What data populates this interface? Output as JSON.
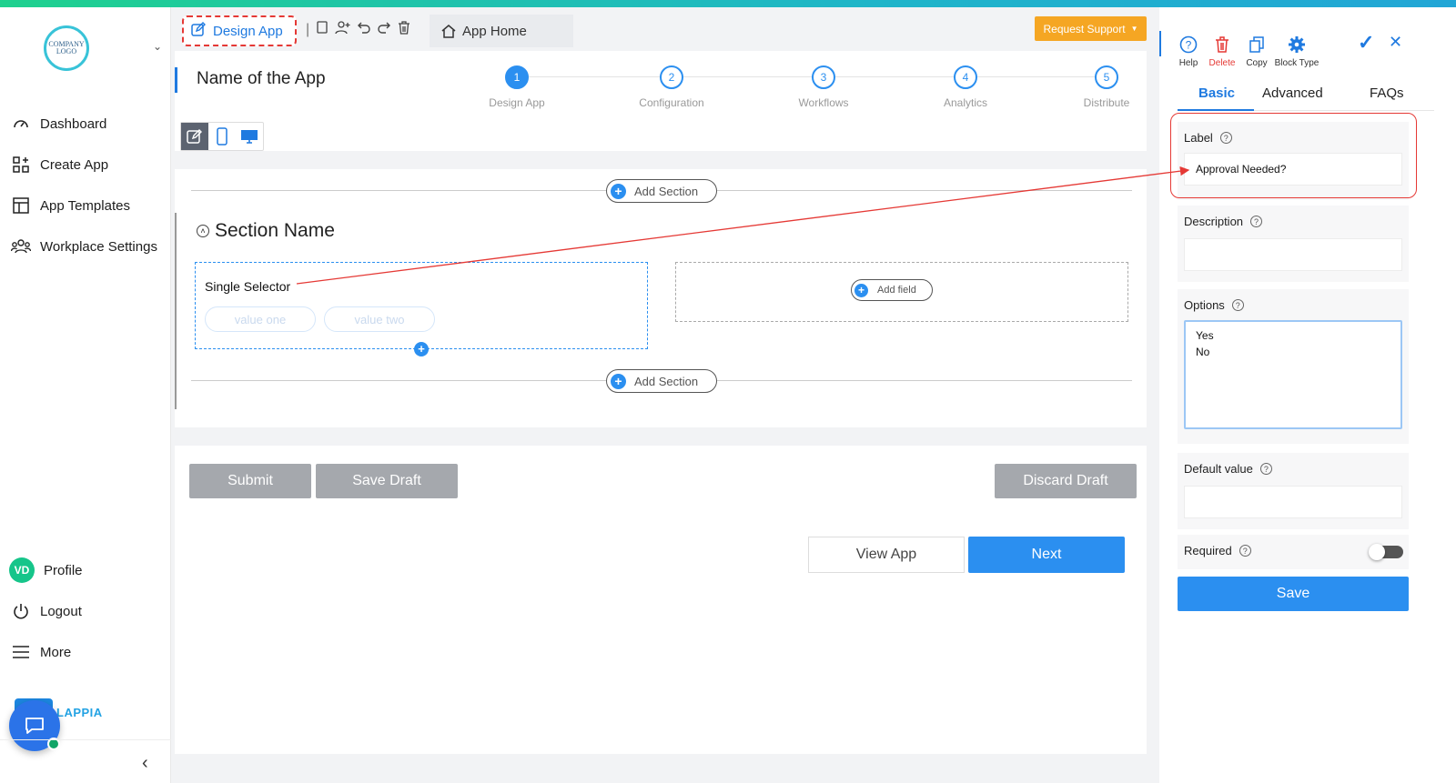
{
  "sidebar": {
    "logo_text": "COMPANY LOGO",
    "items": [
      {
        "label": "Dashboard",
        "icon": "dashboard-gauge-icon"
      },
      {
        "label": "Create App",
        "icon": "create-app-grid-icon"
      },
      {
        "label": "App Templates",
        "icon": "templates-layout-icon"
      },
      {
        "label": "Workplace Settings",
        "icon": "users-group-icon"
      }
    ],
    "bottom": [
      {
        "label": "Profile",
        "avatar": "VD"
      },
      {
        "label": "Logout",
        "icon": "power-icon"
      },
      {
        "label": "More",
        "icon": "hamburger-icon"
      }
    ],
    "brand": "LAPPIA"
  },
  "header": {
    "design_app_tab": "Design App",
    "app_home_tab": "App Home",
    "request_support": "Request Support"
  },
  "builder": {
    "app_name": "Name of the App",
    "steps": [
      {
        "num": "1",
        "label": "Design App",
        "active": true
      },
      {
        "num": "2",
        "label": "Configuration",
        "active": false
      },
      {
        "num": "3",
        "label": "Workflows",
        "active": false
      },
      {
        "num": "4",
        "label": "Analytics",
        "active": false
      },
      {
        "num": "5",
        "label": "Distribute",
        "active": false
      }
    ],
    "add_section": "Add Section",
    "section_name": "Section Name",
    "field": {
      "label": "Single Selector",
      "options": [
        "value one",
        "value two"
      ]
    },
    "add_field": "Add field",
    "buttons": {
      "submit": "Submit",
      "save_draft": "Save Draft",
      "discard_draft": "Discard Draft",
      "view_app": "View App",
      "next": "Next"
    }
  },
  "panel": {
    "toolbar": [
      {
        "label": "Help",
        "icon": "help-icon",
        "color": "#1f7ae0"
      },
      {
        "label": "Delete",
        "icon": "trash-icon",
        "color": "#e53935"
      },
      {
        "label": "Copy",
        "icon": "copy-icon",
        "color": "#1f7ae0"
      },
      {
        "label": "Block Type",
        "icon": "gear-icon",
        "color": "#1f7ae0"
      }
    ],
    "tabs": [
      "Basic",
      "Advanced",
      "FAQs"
    ],
    "active_tab": "Basic",
    "label_title": "Label",
    "label_value": "Approval Needed?",
    "description_title": "Description",
    "description_value": "",
    "options_title": "Options",
    "options_value": "Yes\nNo",
    "default_title": "Default value",
    "default_value": "",
    "required_title": "Required",
    "required_on": false,
    "save": "Save"
  },
  "colors": {
    "accent": "#2b8ff0",
    "highlight": "#e53935",
    "support": "#f5a623",
    "disabled_button": "#a5a8ad"
  }
}
